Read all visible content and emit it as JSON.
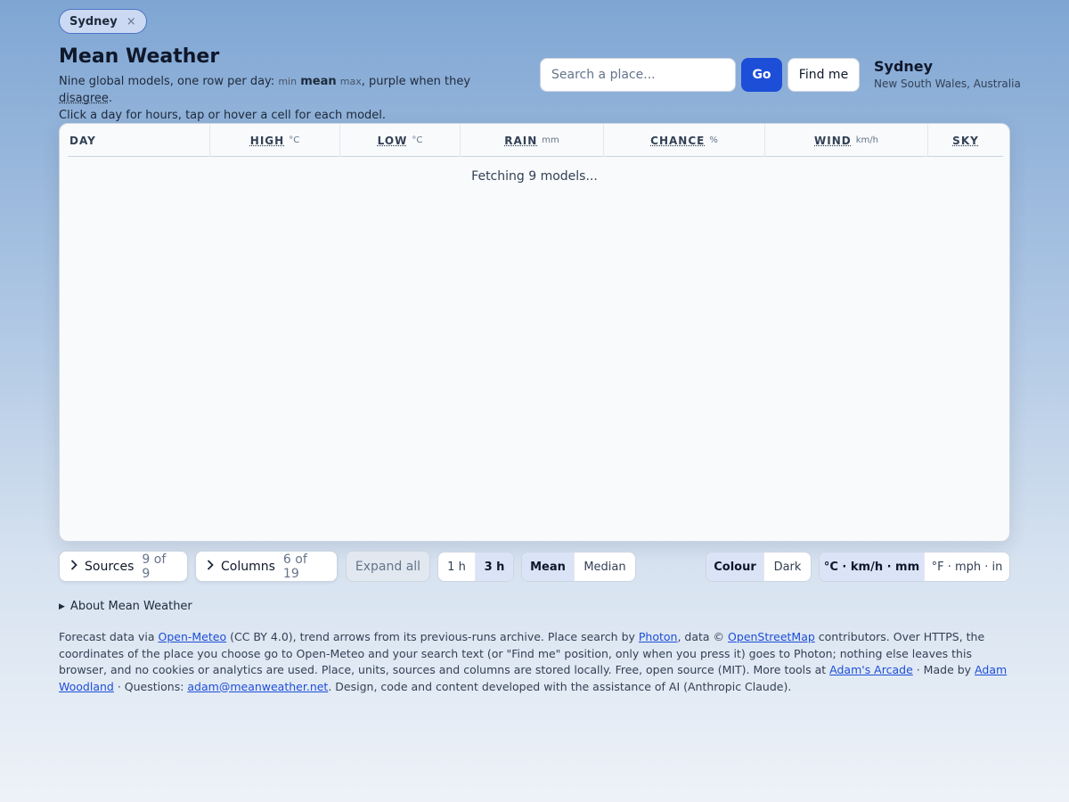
{
  "location_chip": {
    "label": "Sydney",
    "close": "×"
  },
  "header": {
    "title": "Mean Weather",
    "desc_prefix": "Nine global models, one row per day: ",
    "desc_min": "min",
    "desc_mean": "mean",
    "desc_max": "max",
    "desc_mid": ", purple when they ",
    "desc_disagree": "disagree",
    "desc_end": ".",
    "desc_line2": "Click a day for hours, tap or hover a cell for each model."
  },
  "search": {
    "placeholder": "Search a place...",
    "go_label": "Go",
    "find_label": "Find me"
  },
  "place": {
    "name": "Sydney",
    "region": "New South Wales, Australia"
  },
  "table": {
    "columns": [
      {
        "label": "DAY",
        "unit": ""
      },
      {
        "label": "HIGH",
        "unit": "°C"
      },
      {
        "label": "LOW",
        "unit": "°C"
      },
      {
        "label": "RAIN",
        "unit": "mm"
      },
      {
        "label": "CHANCE",
        "unit": "%"
      },
      {
        "label": "WIND",
        "unit": "km/h"
      },
      {
        "label": "SKY",
        "unit": ""
      }
    ],
    "loading_text": "Fetching 9 models..."
  },
  "toolbar": {
    "sources_label": "Sources",
    "sources_count": "9 of 9",
    "columns_label": "Columns",
    "columns_count": "6 of 19",
    "expand_label": "Expand all",
    "interval": [
      "1 h",
      "3 h"
    ],
    "aggregate": [
      "Mean",
      "Median"
    ],
    "theme": [
      "Colour",
      "Dark"
    ],
    "units": [
      "°C · km/h · mm",
      "°F · mph · in"
    ]
  },
  "about": {
    "label": "About Mean Weather"
  },
  "footer": {
    "t1": "Forecast data via ",
    "l1": "Open-Meteo",
    "t2": " (CC BY 4.0), trend arrows from its previous-runs archive. Place search by ",
    "l2": "Photon",
    "t3": ", data © ",
    "l3": "OpenStreetMap",
    "t4": " contributors. Over HTTPS, the coordinates of the place you choose go to Open-Meteo and your search text (or \"Find me\" position, only when you press it) goes to Photon; nothing else leaves this browser, and no cookies or analytics are used. Place, units, sources and columns are stored locally. Free, open source (MIT). More tools at ",
    "l4": "Adam's Arcade",
    "t5": " · Made by ",
    "l5": "Adam Woodland",
    "t6": " · Questions: ",
    "l6": "adam@meanweather.net",
    "t7": ". Design, code and content developed with the assistance of AI (Anthropic Claude)."
  },
  "colors": {
    "accent": "#1d4ed8",
    "chip_border": "#4b74c9"
  }
}
